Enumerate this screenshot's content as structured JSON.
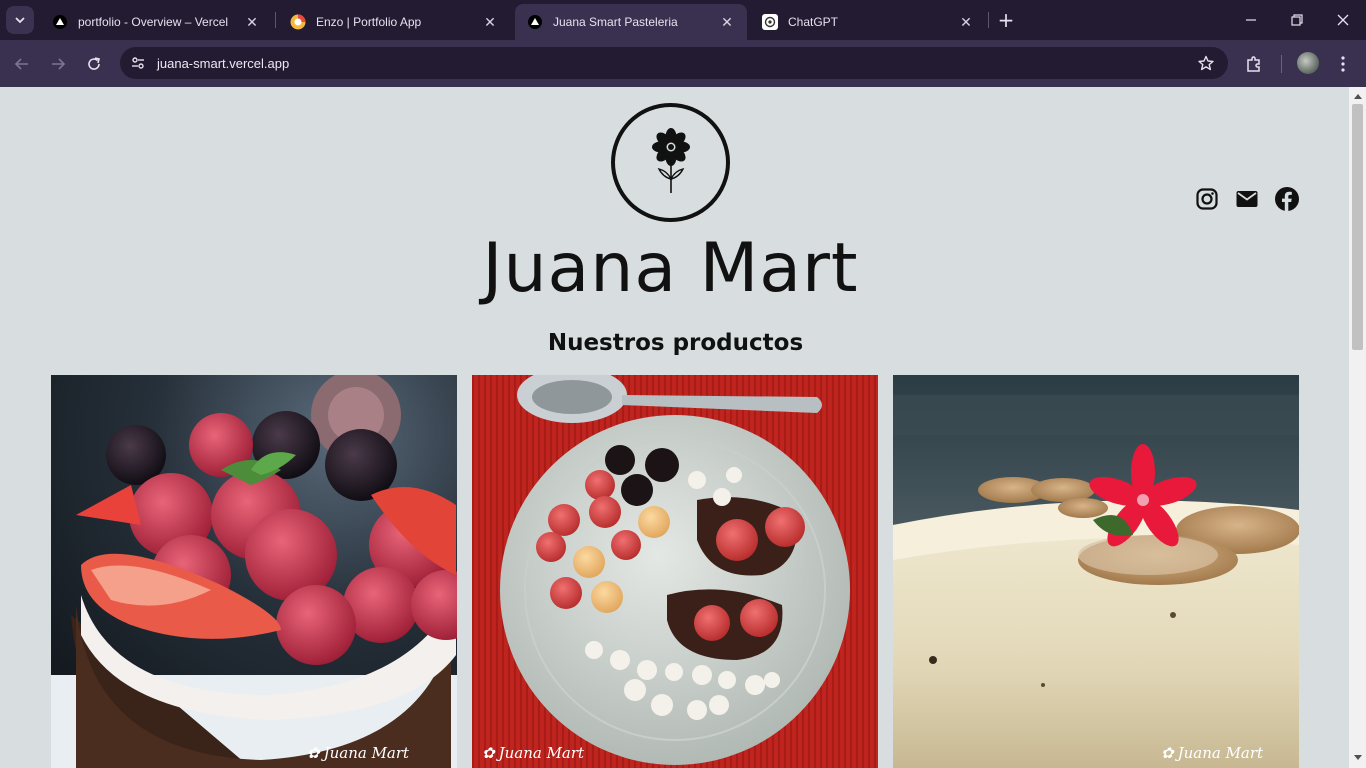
{
  "browser": {
    "tabs": [
      {
        "title": "portfolio - Overview – Vercel",
        "favicon": "vercel-triangle-icon",
        "active": false
      },
      {
        "title": "Enzo | Portfolio App",
        "favicon": "portfolio-app-icon",
        "active": false
      },
      {
        "title": "Juana Smart Pasteleria",
        "favicon": "vercel-triangle-icon",
        "active": true
      },
      {
        "title": "ChatGPT",
        "favicon": "chatgpt-icon",
        "active": false
      }
    ],
    "url": "juana-smart.vercel.app",
    "colors": {
      "tabbar": "#221b31",
      "toolbar": "#3a3150",
      "omnibox": "#221b31"
    }
  },
  "page": {
    "brand": "Juana Mart",
    "section_title": "Nuestros productos",
    "social": [
      "instagram-icon",
      "mail-icon",
      "facebook-icon"
    ],
    "products": [
      {
        "name": "product-image-berry-tart",
        "watermark": "Juana Mart"
      },
      {
        "name": "product-image-chocolate-berries-plate",
        "watermark": "Juana Mart"
      },
      {
        "name": "product-image-cheesecake",
        "watermark": "Juana Mart"
      }
    ],
    "colors": {
      "background": "#d8dedf",
      "text": "#111111"
    }
  }
}
